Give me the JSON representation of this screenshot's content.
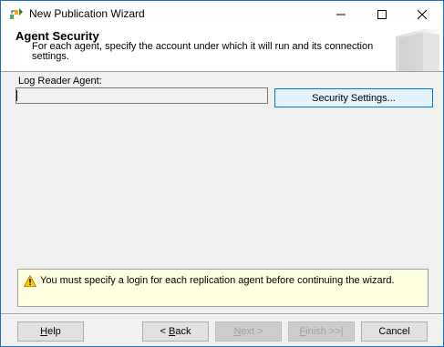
{
  "window": {
    "title": "New Publication Wizard"
  },
  "header": {
    "title": "Agent Security",
    "description": "For each agent, specify the account under which it will run and its connection settings."
  },
  "log_reader": {
    "label": "Log Reader Agent:",
    "value": "",
    "security_button": "Security Settings..."
  },
  "warning": {
    "message": "You must specify a login for each replication agent before continuing the wizard.",
    "icon": "warning-icon",
    "color": "#ffffe1"
  },
  "footer": {
    "help": {
      "prefix": "",
      "mnemonic": "H",
      "suffix": "elp"
    },
    "back": {
      "prefix": "< ",
      "mnemonic": "B",
      "suffix": "ack"
    },
    "next": {
      "prefix": "",
      "mnemonic": "N",
      "suffix": "ext >"
    },
    "finish": {
      "prefix": "",
      "mnemonic": "F",
      "suffix": "inish >>|"
    },
    "cancel": "Cancel"
  },
  "colors": {
    "window_border": "#1e6fc2",
    "accent": "#0078d7",
    "dialog_bg": "#f0f0f0"
  }
}
